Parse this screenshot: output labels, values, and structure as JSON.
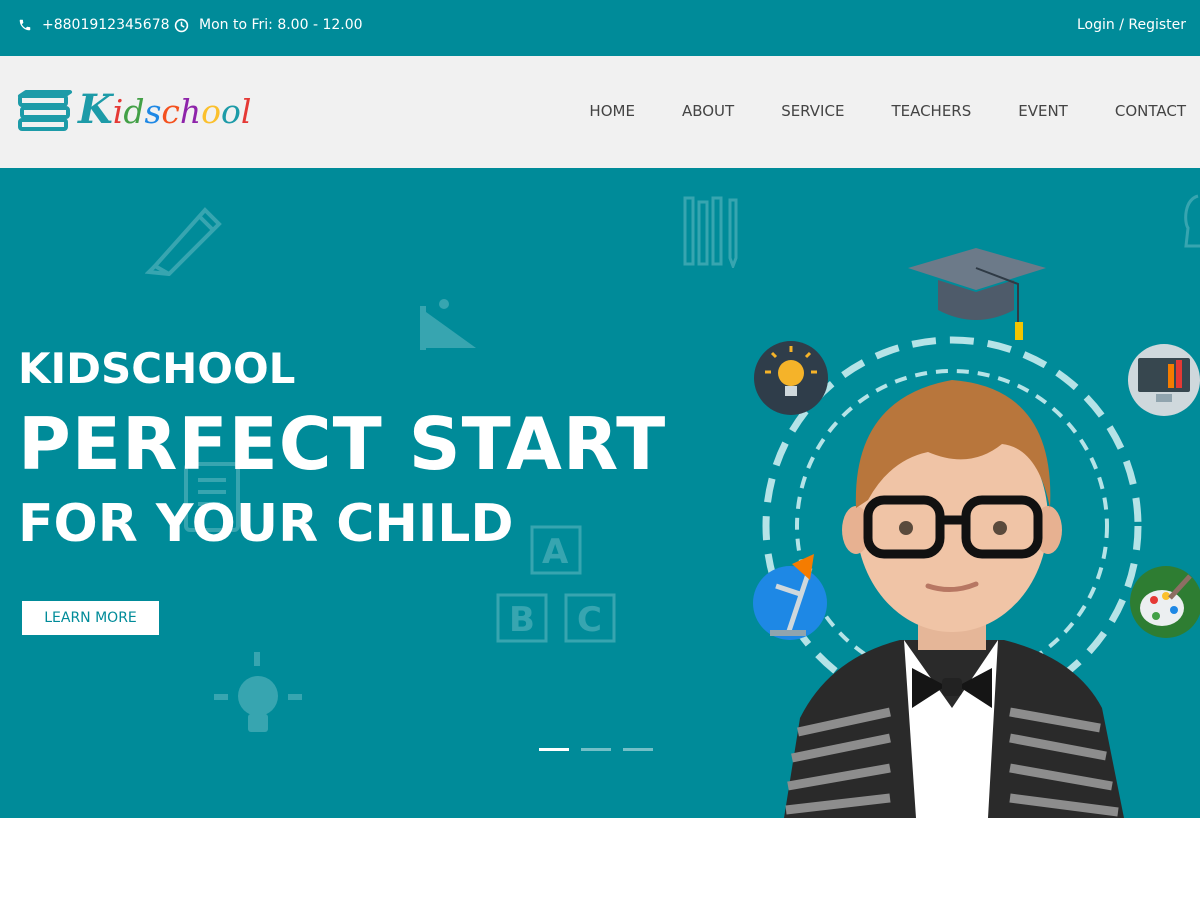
{
  "topbar": {
    "phone": "+8801912345678",
    "hours": "Mon to Fri: 8.00 - 12.00",
    "auth": "Login / Register"
  },
  "brand": {
    "logo_text": "Kidschool",
    "logo_letters": [
      "K",
      "i",
      "d",
      "s",
      "c",
      "h",
      "o",
      "o",
      "l"
    ],
    "logo_colors": [
      "#1d9ba8",
      "#e53935",
      "#43a047",
      "#1e88e5",
      "#f4511e",
      "#8e24aa",
      "#fbc02d",
      "#1d9ba8",
      "#e53935"
    ]
  },
  "nav": {
    "items": [
      "HOME",
      "ABOUT",
      "SERVICE",
      "TEACHERS",
      "EVENT",
      "CONTACT"
    ]
  },
  "hero": {
    "kicker": "KIDSCHOOL",
    "title": "PERFECT START",
    "subtitle": "FOR YOUR CHILD",
    "cta": "LEARN MORE",
    "slides": 3,
    "active_slide": 1
  },
  "colors": {
    "primary": "#008b99",
    "header_bg": "#f1f1f1",
    "white": "#ffffff"
  },
  "icons": {
    "phone": "phone-icon",
    "clock": "clock-icon",
    "graduation_cap": "graduation-cap-icon",
    "lightbulb": "lightbulb-icon",
    "computer": "computer-icon",
    "desk_lamp": "desk-lamp-icon",
    "palette": "palette-icon"
  }
}
